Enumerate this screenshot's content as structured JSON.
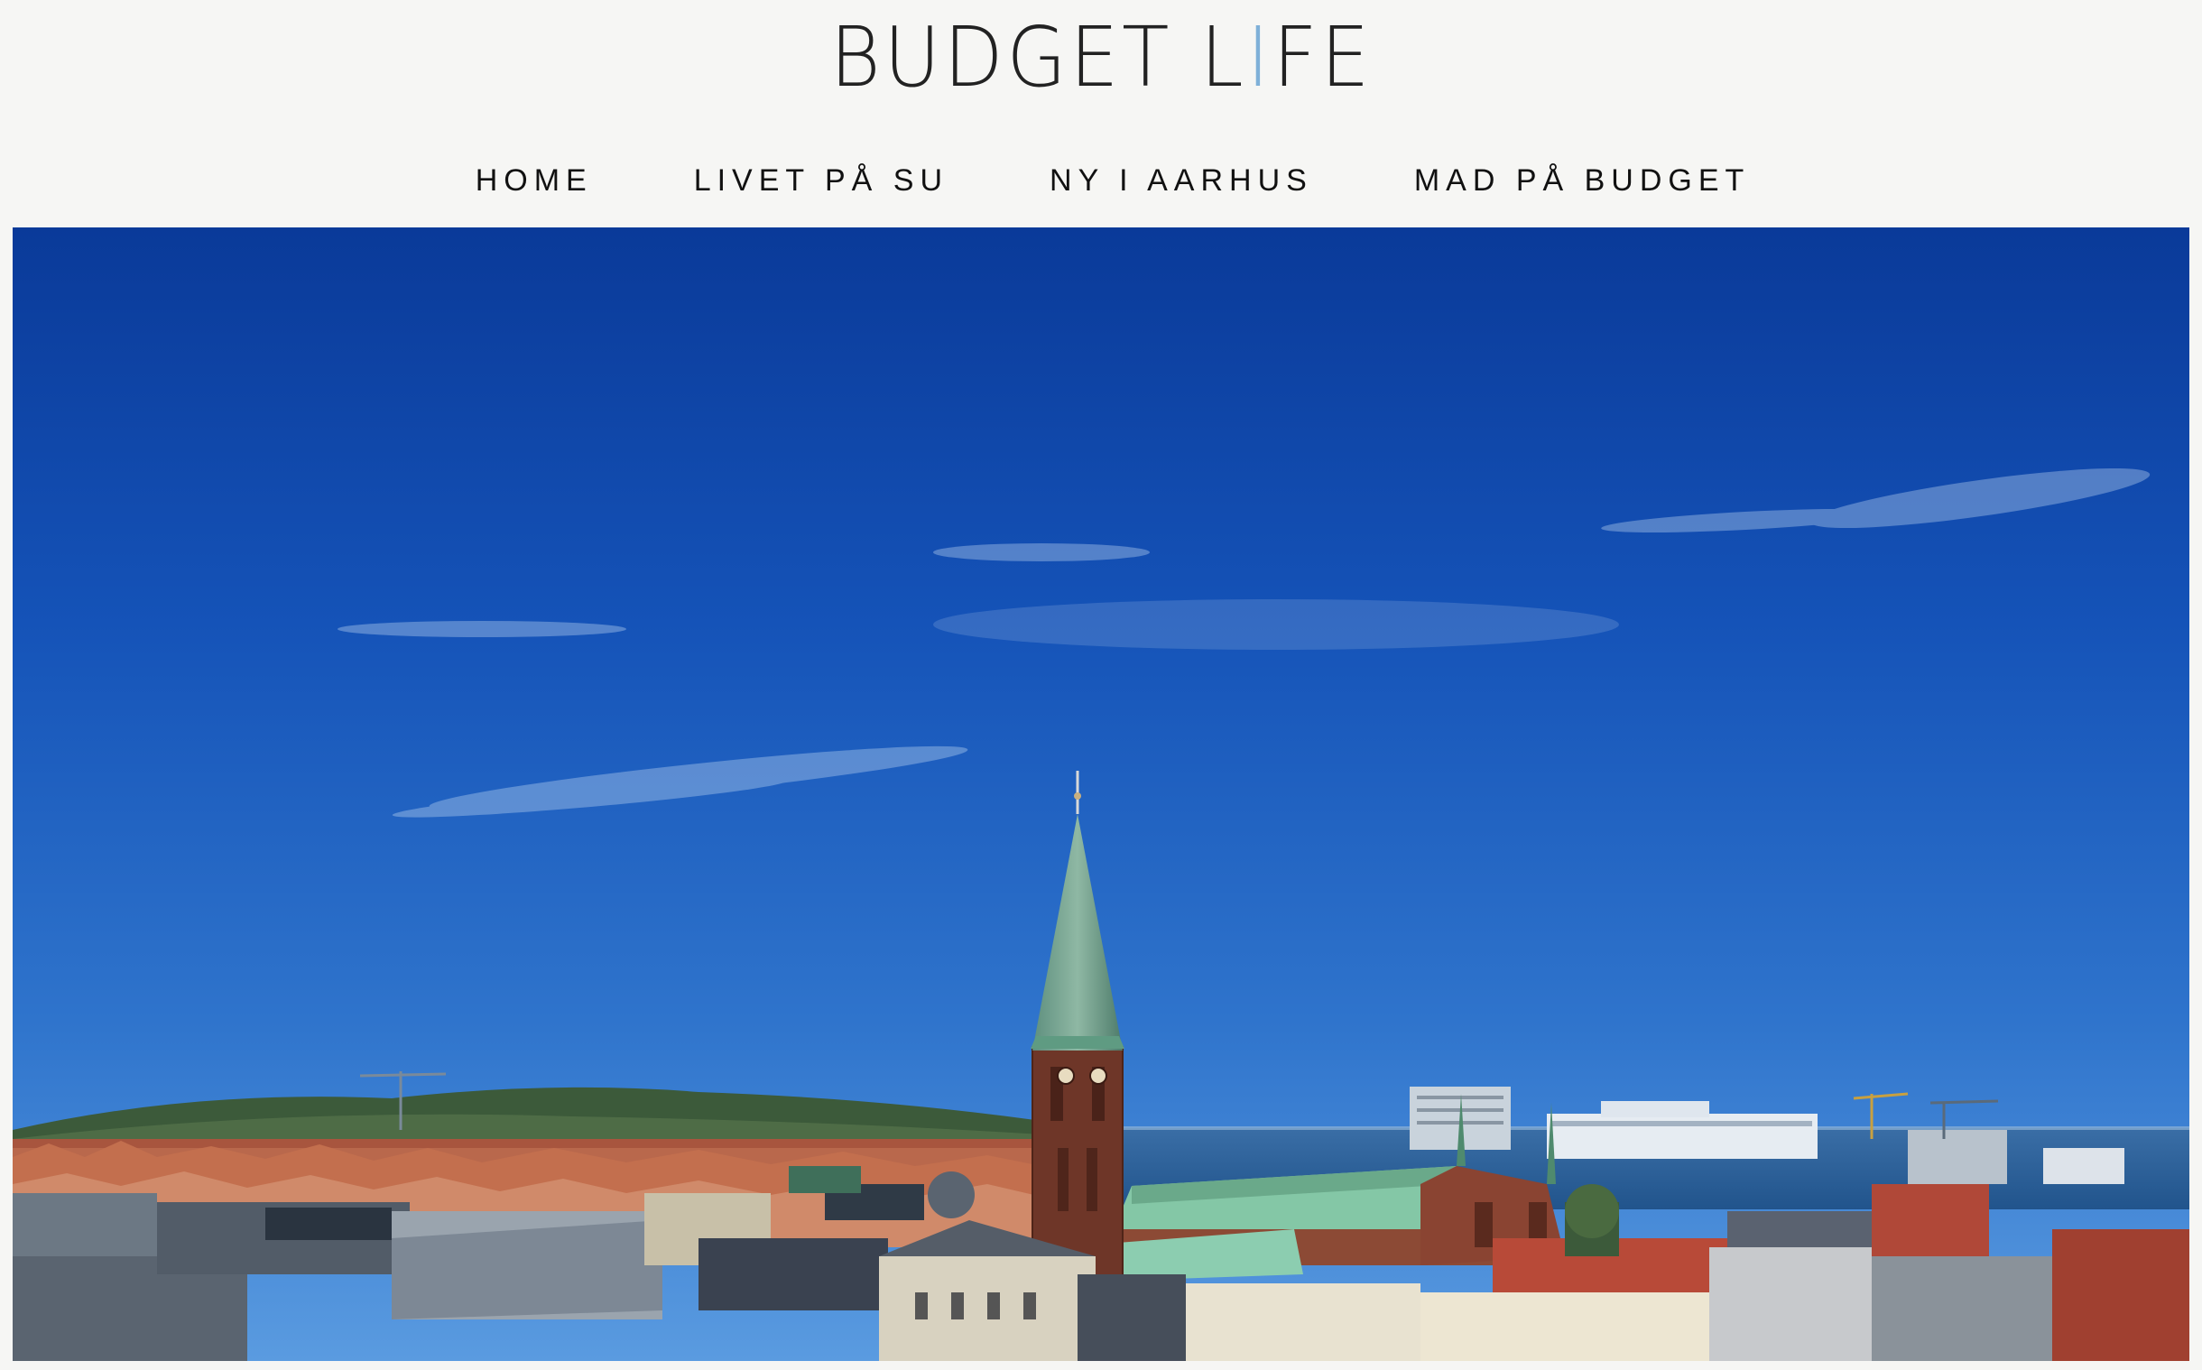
{
  "site": {
    "logo_left": "BUDGET L",
    "logo_i": "I",
    "logo_right": "FE"
  },
  "nav": {
    "items": [
      {
        "label": "HOME"
      },
      {
        "label": "LIVET PÅ SU"
      },
      {
        "label": "NY I AARHUS"
      },
      {
        "label": "MAD PÅ BUDGET"
      }
    ]
  },
  "hero": {
    "colors": {
      "sky_top": "#0a3fa0",
      "sky_bottom": "#4a8bd6",
      "cathedral_brick": "#6b3a2a",
      "copper_roof": "#7fc2a2",
      "sea": "#2b5d93"
    }
  }
}
